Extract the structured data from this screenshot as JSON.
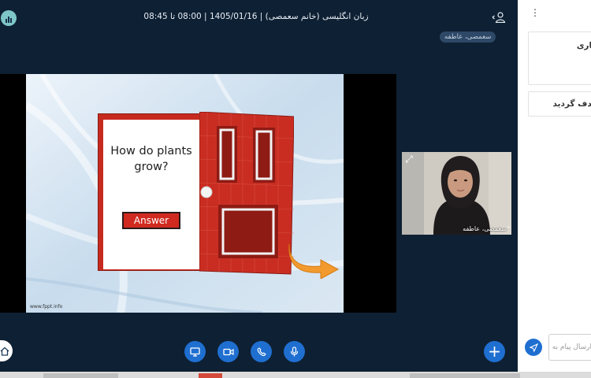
{
  "header": {
    "meeting_title": "زبان انگلیسی (خانم سعمصی) | 1405/01/16 | 08:00 تا 08:45",
    "active_speaker": "سعمصی، عاطفه",
    "logo_icon": "bar-chart-logo-icon",
    "user_icon": "user-icon"
  },
  "slide": {
    "question": "How do plants grow?",
    "answer_button": "Answer",
    "credit": "www.fppt.info"
  },
  "webcam": {
    "name": "سعمصی، عاطفه",
    "expand_icon": "expand-icon",
    "caret": "^"
  },
  "controls": {
    "items": [
      {
        "name": "screen-share-icon"
      },
      {
        "name": "camera-icon"
      },
      {
        "name": "phone-icon"
      },
      {
        "name": "microphone-icon"
      }
    ],
    "add_label": "+",
    "home_icon": "home-icon"
  },
  "sidepanel": {
    "menu_icon": "more-vertical-icon",
    "card1_text": "جاری",
    "card2_text": "حدف گردید",
    "chat_placeholder": "ارسال پیام به همه...",
    "send_icon": "send-icon"
  },
  "colors": {
    "background": "#0e2033",
    "accent": "#1f6fd1",
    "door_red": "#c62a1f",
    "panel": "#ffffff"
  }
}
